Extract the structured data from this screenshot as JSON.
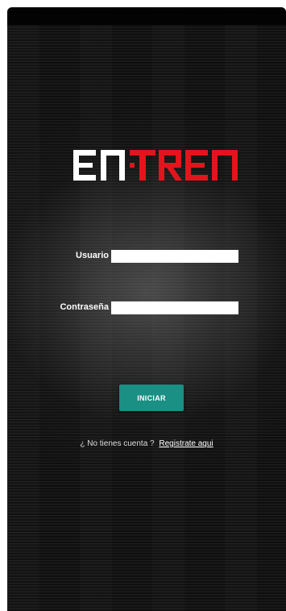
{
  "app": {
    "logo_text": "ENTREN",
    "logo_colors": {
      "white_part": "#ffffff",
      "red_part": "#e3141c"
    }
  },
  "form": {
    "username_label": "Usuario",
    "username_value": "",
    "password_label": "Contraseña",
    "password_value": "",
    "submit_label": "INICIAR",
    "submit_color": "#1a8f83"
  },
  "register": {
    "prompt": "¿ No tienes cuenta ?",
    "link_label": "Registrate aqui"
  }
}
